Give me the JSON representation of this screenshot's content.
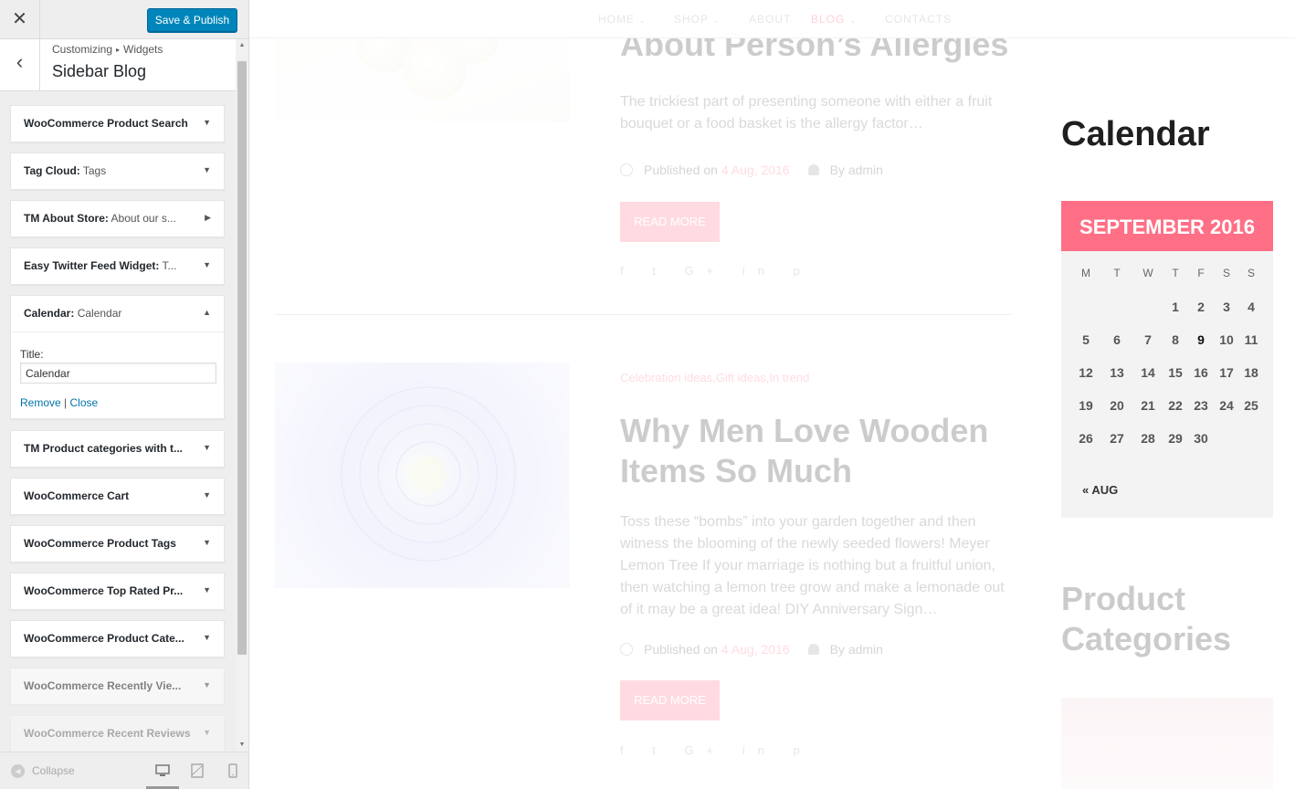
{
  "customizer": {
    "close_label": "✕",
    "save_label": "Save & Publish",
    "back_label": "‹",
    "breadcrumb": [
      "Customizing",
      "Widgets"
    ],
    "breadcrumb_sep": "▸",
    "section_title": "Sidebar Blog",
    "widgets": [
      {
        "name": "WooCommerce Product Search",
        "sub": "",
        "arrow": "▼"
      },
      {
        "name": "Tag Cloud:",
        "sub": " Tags",
        "arrow": "▼"
      },
      {
        "name": "TM About Store:",
        "sub": " About our s...",
        "arrow": "▶"
      },
      {
        "name": "Easy Twitter Feed Widget:",
        "sub": " T...",
        "arrow": "▼"
      },
      {
        "name": "Calendar:",
        "sub": " Calendar",
        "arrow": "▲"
      },
      {
        "name": "TM Product categories with t...",
        "sub": "",
        "arrow": "▼"
      },
      {
        "name": "WooCommerce Cart",
        "sub": "",
        "arrow": "▼"
      },
      {
        "name": "WooCommerce Product Tags",
        "sub": "",
        "arrow": "▼"
      },
      {
        "name": "WooCommerce Top Rated Pr...",
        "sub": "",
        "arrow": "▼"
      },
      {
        "name": "WooCommerce Product Cate...",
        "sub": "",
        "arrow": "▼"
      },
      {
        "name": "WooCommerce Recently Vie...",
        "sub": "",
        "arrow": "▼"
      },
      {
        "name": "WooCommerce Recent Reviews",
        "sub": "",
        "arrow": "▼"
      }
    ],
    "calendar_form": {
      "title_label": "Title:",
      "title_value": "Calendar",
      "remove_label": "Remove",
      "separator": " | ",
      "close_label": "Close"
    },
    "footer": {
      "collapse_label": "Collapse",
      "collapse_icon": "◀"
    },
    "scroll": {
      "up": "▲",
      "down": "▼"
    }
  },
  "preview": {
    "nav": [
      {
        "label": "HOME",
        "chevron": "⌄"
      },
      {
        "label": "SHOP",
        "chevron": "⌄"
      },
      {
        "label": "ABOUT",
        "chevron": ""
      },
      {
        "label": "BLOG",
        "chevron": "⌄"
      },
      {
        "label": "CONTACTS",
        "chevron": ""
      }
    ],
    "post1": {
      "title": "About Person’s Allergies",
      "excerpt": "The trickiest part of presenting someone with either a fruit bouquet or a food basket is the allergy factor…",
      "published_label": "Published on ",
      "date": "4 Aug, 2016",
      "by_label": "By admin",
      "read_more": "READ MORE",
      "social": "f  t  G+  in  p"
    },
    "post2": {
      "categories": "Celebration ideas,Gift ideas,In trend",
      "title": "Why Men Love Wooden Items So Much",
      "excerpt": "Toss these “bombs” into your garden together and then witness the blooming of the newly seeded flowers!  Meyer Lemon Tree If your marriage is nothing but a fruitful union, then watching a lemon tree grow and make a lemonade out of it may be a great idea!  DIY Anniversary Sign…",
      "published_label": "Published on ",
      "date": "4 Aug, 2016",
      "by_label": "By admin",
      "read_more": "READ MORE",
      "social": "f  t  G+  in  p"
    },
    "calendar": {
      "heading": "Calendar",
      "month": "SEPTEMBER 2016",
      "weekdays": [
        "M",
        "T",
        "W",
        "T",
        "F",
        "S",
        "S"
      ],
      "weeks": [
        [
          "",
          "",
          "",
          "1",
          "2",
          "3",
          "4"
        ],
        [
          "5",
          "6",
          "7",
          "8",
          "9",
          "10",
          "11"
        ],
        [
          "12",
          "13",
          "14",
          "15",
          "16",
          "17",
          "18"
        ],
        [
          "19",
          "20",
          "21",
          "22",
          "23",
          "24",
          "25"
        ],
        [
          "26",
          "27",
          "28",
          "29",
          "30",
          "",
          ""
        ]
      ],
      "today": "9",
      "prev_link": "« AUG"
    },
    "product_categories_heading": "Product Categories",
    "colors": {
      "accent": "#ff6f85",
      "admin_blue": "#0085ba"
    }
  }
}
